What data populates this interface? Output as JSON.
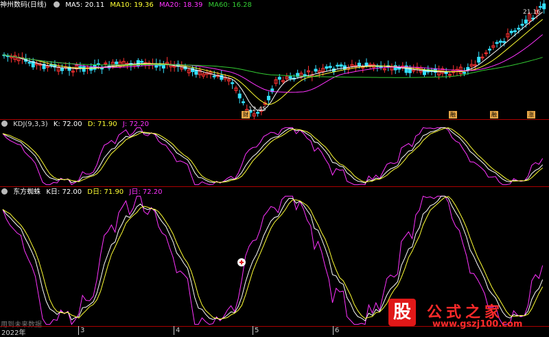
{
  "price_panel": {
    "title": "神州数码(日线)",
    "ma": [
      {
        "label": "MA5: 20.11",
        "color": "#ffffff"
      },
      {
        "label": "MA10: 19.36",
        "color": "#ffff33"
      },
      {
        "label": "MA20: 18.39",
        "color": "#ff33ff"
      },
      {
        "label": "MA60: 16.28",
        "color": "#33cc33"
      }
    ],
    "high_label": "21.16",
    "low_label": "12.45",
    "events": [
      "财",
      "融",
      "融",
      "涨"
    ]
  },
  "kdj_panel": {
    "title": "KDJ(9,3,3)",
    "k": "K: 72.00",
    "d": "D: 71.90",
    "j": "J: 72.20"
  },
  "spider_panel": {
    "title": "东方蜘蛛",
    "k": "K日: 72.00",
    "d": "D日: 71.90",
    "j": "J日: 72.20"
  },
  "x_axis": {
    "labels": [
      "2022年",
      "3",
      "4",
      "5",
      "6"
    ]
  },
  "watermark": "用到未来数据",
  "logo": {
    "mark": "股",
    "name": "公式之家",
    "url": "www.gszj100.com"
  },
  "colors": {
    "rise": "#ff3232",
    "fall": "#33e0ff",
    "k": "#ffffff",
    "d": "#ffff33",
    "j": "#ff33ff",
    "ma60": "#33cc33",
    "separator": "#aa0000"
  },
  "chart_data": [
    {
      "type": "line",
      "title": "神州数码(日线)",
      "series": [
        {
          "name": "MA5",
          "last": 20.11
        },
        {
          "name": "MA10",
          "last": 19.36
        },
        {
          "name": "MA20",
          "last": 18.39
        },
        {
          "name": "MA60",
          "last": 16.28
        }
      ],
      "annotations": [
        {
          "text": "21.16"
        },
        {
          "text": "12.45"
        }
      ]
    },
    {
      "type": "line",
      "title": "KDJ(9,3,3)",
      "series": [
        {
          "name": "K",
          "last": 72.0
        },
        {
          "name": "D",
          "last": 71.9
        },
        {
          "name": "J",
          "last": 72.2
        }
      ]
    },
    {
      "type": "line",
      "title": "东方蜘蛛",
      "series": [
        {
          "name": "K日",
          "last": 72.0
        },
        {
          "name": "D日",
          "last": 71.9
        },
        {
          "name": "J日",
          "last": 72.2
        }
      ]
    }
  ]
}
